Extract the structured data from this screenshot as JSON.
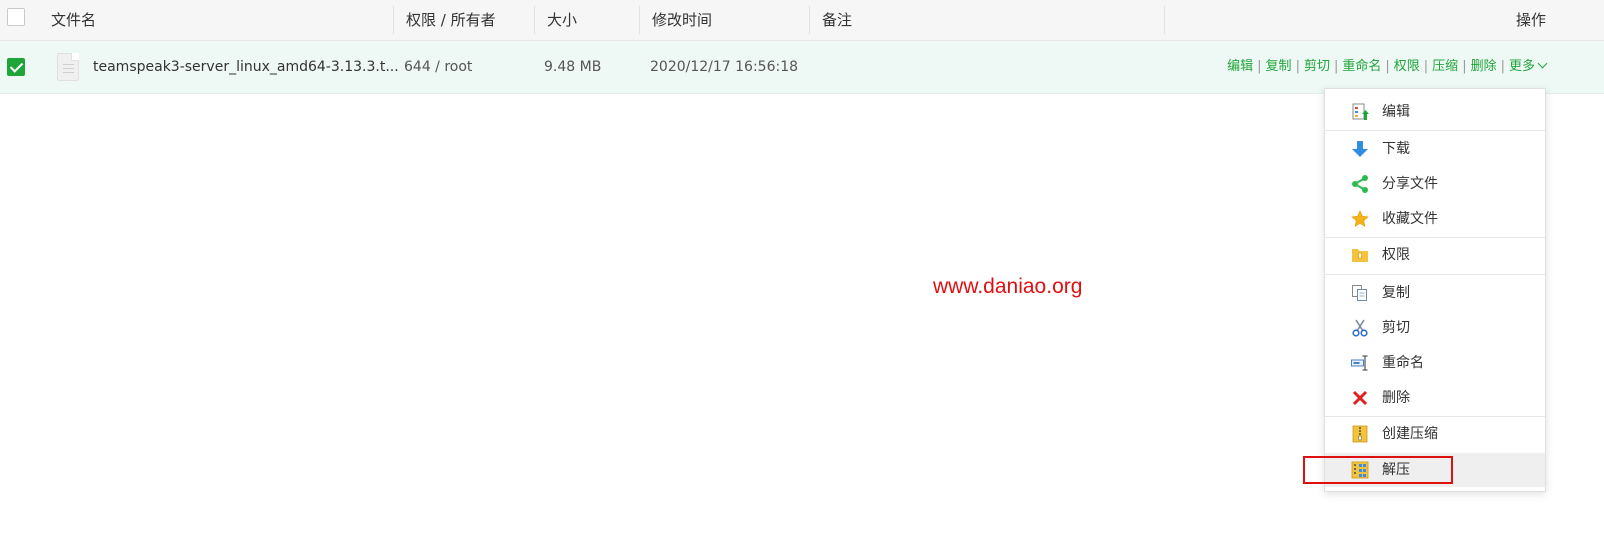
{
  "table": {
    "headers": {
      "name": "文件名",
      "perm_owner": "权限 / 所有者",
      "size": "大小",
      "mtime": "修改时间",
      "note": "备注",
      "ops": "操作"
    },
    "rows": [
      {
        "checked": true,
        "name": "teamspeak3-server_linux_amd64-3.13.3.t...",
        "perm_owner": "644 / root",
        "size": "9.48 MB",
        "mtime": "2020/12/17 16:56:18",
        "ops": {
          "edit": "编辑",
          "copy": "复制",
          "cut": "剪切",
          "rename": "重命名",
          "perm": "权限",
          "compress": "压缩",
          "delete": "删除",
          "more": "更多"
        }
      }
    ]
  },
  "watermark": "www.daniao.org",
  "context_menu": {
    "items": [
      {
        "label": "编辑",
        "icon": "edit-icon"
      },
      {
        "label": "下载",
        "icon": "download-icon"
      },
      {
        "label": "分享文件",
        "icon": "share-icon"
      },
      {
        "label": "收藏文件",
        "icon": "star-icon"
      },
      {
        "label": "权限",
        "icon": "lock-folder-icon"
      },
      {
        "label": "复制",
        "icon": "copy-icon"
      },
      {
        "label": "剪切",
        "icon": "scissors-icon"
      },
      {
        "label": "重命名",
        "icon": "rename-icon"
      },
      {
        "label": "删除",
        "icon": "delete-icon"
      },
      {
        "label": "创建压缩",
        "icon": "zip-icon"
      },
      {
        "label": "解压",
        "icon": "unzip-icon"
      }
    ],
    "active_item": "解压"
  },
  "colors": {
    "accent": "#20a53a",
    "row_selected": "#eef8f4",
    "highlight": "#e01010"
  }
}
